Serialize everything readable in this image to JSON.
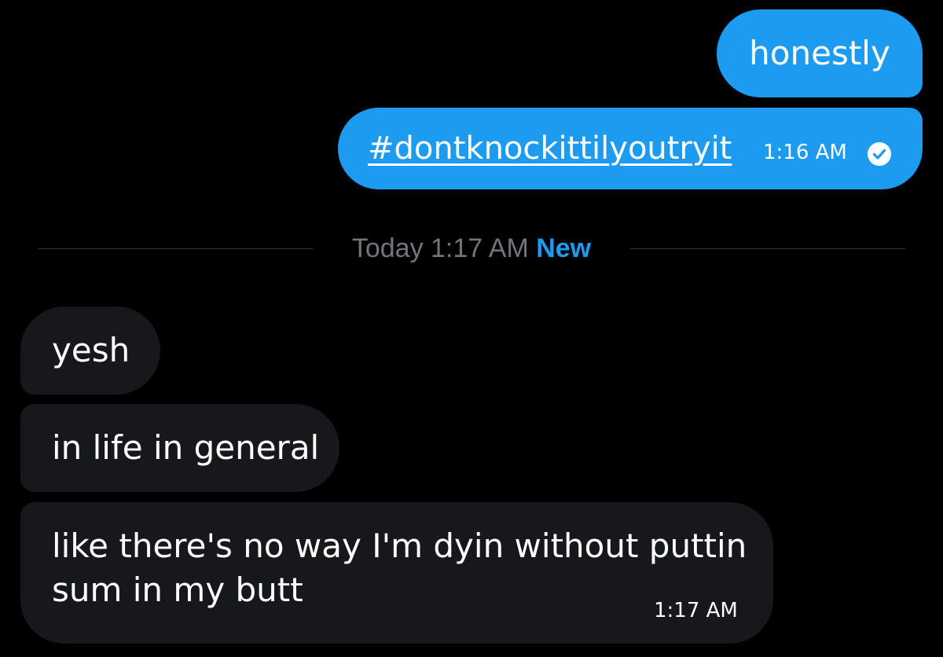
{
  "colors": {
    "background": "#000000",
    "sent_bubble": "#1d9bf0",
    "received_bubble": "#16181c",
    "muted_text": "#71767b",
    "accent": "#1d9bf0"
  },
  "sent_messages": [
    {
      "text": "honestly"
    },
    {
      "text": "#dontknockittilyoutryit",
      "time": "1:16 AM",
      "status_icon": "check-circle-icon"
    }
  ],
  "divider": {
    "date_label": "Today 1:17 AM",
    "new_label": "New"
  },
  "received_messages": [
    {
      "text": "yesh"
    },
    {
      "text": "in life in general"
    },
    {
      "lines": [
        "like there's no way I'm dyin without puttin",
        "sum in my butt"
      ],
      "time": "1:17 AM"
    }
  ]
}
